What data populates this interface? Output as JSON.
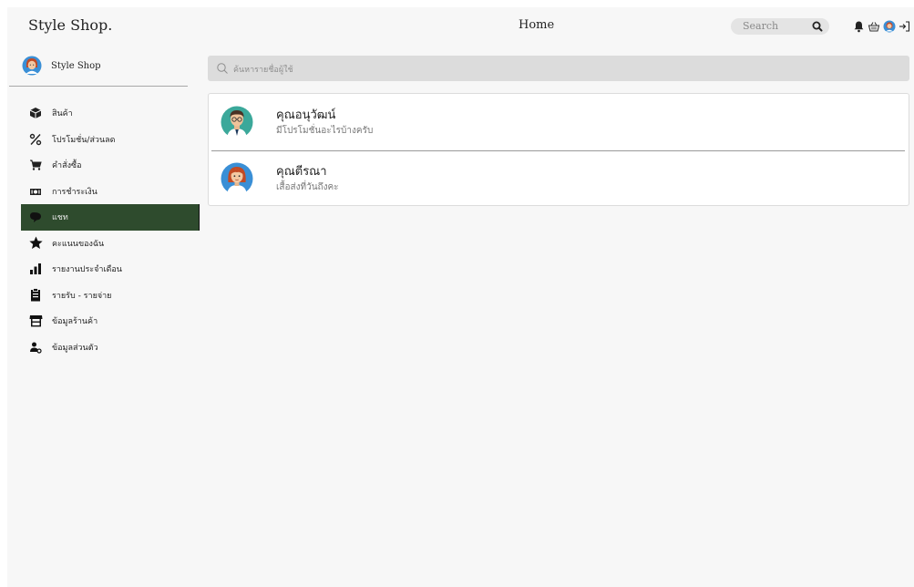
{
  "header": {
    "brand": "Style Shop.",
    "page_title": "Home",
    "search_placeholder": "Search"
  },
  "sidebar": {
    "profile_name": "Style Shop",
    "items": [
      {
        "label": "สินค้า",
        "icon": "box-icon",
        "active": false
      },
      {
        "label": "โปรโมชั่น/ส่วนลด",
        "icon": "percent-icon",
        "active": false
      },
      {
        "label": "คำสั่งซื้อ",
        "icon": "cart-icon",
        "active": false
      },
      {
        "label": "การชำระเงิน",
        "icon": "money-icon",
        "active": false
      },
      {
        "label": "แชท",
        "icon": "chat-icon",
        "active": true
      },
      {
        "label": "คะแนนของฉัน",
        "icon": "star-icon",
        "active": false
      },
      {
        "label": "รายงานประจำเดือน",
        "icon": "bar-chart-icon",
        "active": false
      },
      {
        "label": "รายรับ - รายจ่าย",
        "icon": "clipboard-icon",
        "active": false
      },
      {
        "label": "ข้อมูลร้านค้า",
        "icon": "store-icon",
        "active": false
      },
      {
        "label": "ข้อมูลส่วนตัว",
        "icon": "user-settings-icon",
        "active": false
      }
    ]
  },
  "main": {
    "search_placeholder": "ค้นหารายชื่อผู้ใช้",
    "chats": [
      {
        "name": "คุณอนุวัฒน์",
        "message": "มีโปรโมชั่นอะไรบ้างครับ",
        "avatar": "male-avatar-icon"
      },
      {
        "name": "คุณตีรณา",
        "message": "เสื้อส่งที่วันถึงคะ",
        "avatar": "female-avatar-icon"
      }
    ]
  },
  "colors": {
    "active_menu_bg": "#2e4b2d",
    "background": "#f7f7f7",
    "search_bg": "#dcdcdc"
  }
}
